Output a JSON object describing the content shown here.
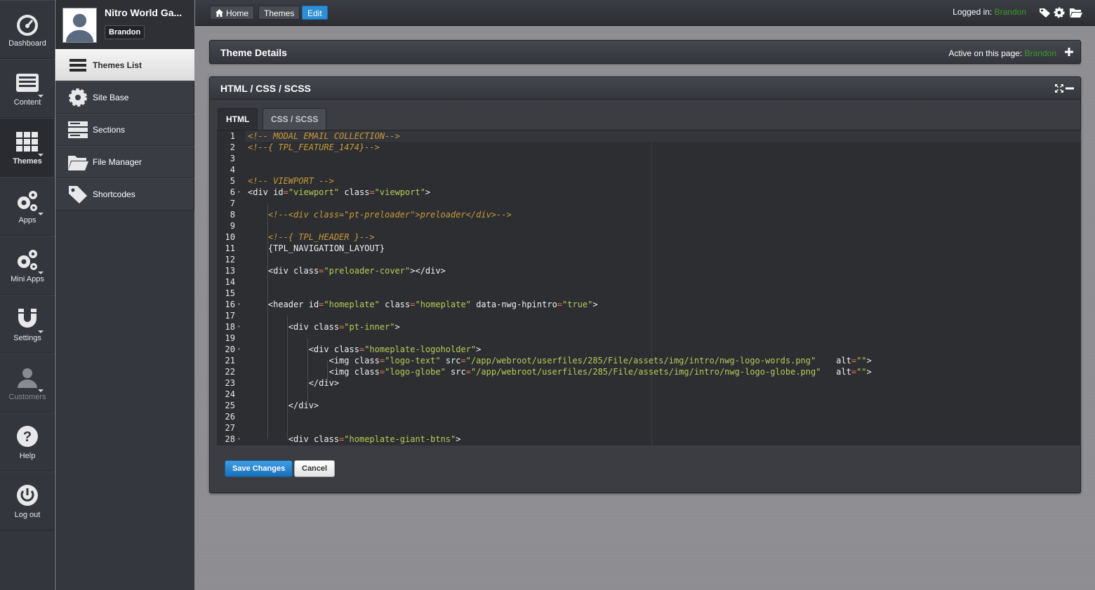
{
  "rail": {
    "items": [
      {
        "label": "Dashboard",
        "icon": "dashboard-icon"
      },
      {
        "label": "Content",
        "icon": "content-icon"
      },
      {
        "label": "Themes",
        "icon": "themes-grid-icon"
      },
      {
        "label": "Apps",
        "icon": "gears-icon"
      },
      {
        "label": "Mini Apps",
        "icon": "gears-icon"
      },
      {
        "label": "Settings",
        "icon": "magnet-icon"
      },
      {
        "label": "Customers",
        "icon": "user-icon"
      },
      {
        "label": "Help",
        "icon": "help-icon"
      },
      {
        "label": "Log out",
        "icon": "power-icon"
      }
    ]
  },
  "profile": {
    "site_name": "Nitro World Ga...",
    "user": "Brandon"
  },
  "subnav": {
    "items": [
      {
        "label": "Themes List",
        "icon": "list-icon"
      },
      {
        "label": "Site Base",
        "icon": "gear-icon"
      },
      {
        "label": "Sections",
        "icon": "sections-icon"
      },
      {
        "label": "File Manager",
        "icon": "folder-icon"
      },
      {
        "label": "Shortcodes",
        "icon": "tag-icon"
      }
    ]
  },
  "topbar": {
    "breadcrumb": [
      "Home",
      "Themes",
      "Edit"
    ],
    "logged_in_label": "Logged in:",
    "logged_in_user": "Brandon"
  },
  "theme_details": {
    "title": "Theme Details",
    "active_label": "Active on this page:",
    "active_user": "Brandon"
  },
  "editor": {
    "title": "HTML / CSS / SCSS",
    "tabs": [
      "HTML",
      "CSS / SCSS"
    ],
    "save_label": "Save Changes",
    "cancel_label": "Cancel",
    "line_numbers": [
      "1",
      "2",
      "3",
      "4",
      "5",
      "6",
      "7",
      "8",
      "9",
      "10",
      "11",
      "12",
      "13",
      "14",
      "15",
      "16",
      "17",
      "18",
      "19",
      "20",
      "21",
      "22",
      "23",
      "24",
      "25",
      "26",
      "27",
      "28"
    ],
    "lines": [
      "<!-- MODAL EMAIL COLLECTION-->",
      "<!--{ TPL_FEATURE_1474}-->",
      "",
      "",
      "<!-- VIEWPORT -->",
      "<div id=\"viewport\" class=\"viewport\">",
      "",
      "    <!--<div class=\"pt-preloader\">preloader</div>-->",
      "",
      "    <!--{ TPL_HEADER }-->",
      "    {TPL_NAVIGATION_LAYOUT}",
      "",
      "    <div class=\"preloader-cover\"></div>",
      "",
      "",
      "    <header id=\"homeplate\" class=\"homeplate\" data-nwg-hpintro=\"true\">",
      "",
      "        <div class=\"pt-inner\">",
      "",
      "            <div class=\"homeplate-logoholder\">",
      "                <img class=\"logo-text\" src=\"/app/webroot/userfiles/285/File/assets/img/intro/nwg-logo-words.png\"    alt=\"\">",
      "                <img class=\"logo-globe\" src=\"/app/webroot/userfiles/285/File/assets/img/intro/nwg-logo-globe.png\"   alt=\"\">",
      "            </div>",
      "",
      "        </div>",
      "",
      "",
      "        <div class=\"homeplate-giant-btns\">"
    ]
  },
  "colors": {
    "accent_blue": "#2d8fd6",
    "user_green": "#3a9a2a",
    "editor_bg": "#2d2e32",
    "comment": "#c89a3a",
    "string": "#b6cc57"
  }
}
